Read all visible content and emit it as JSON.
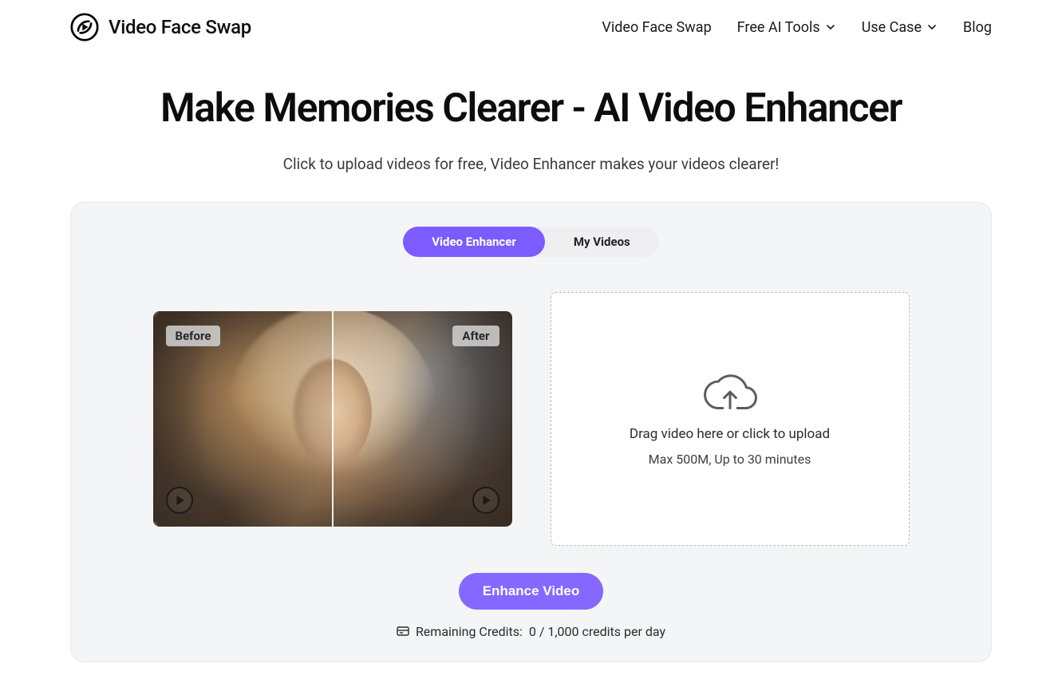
{
  "brand": {
    "title": "Video Face Swap"
  },
  "nav": {
    "items": [
      {
        "label": "Video Face Swap",
        "has_caret": false
      },
      {
        "label": "Free AI Tools",
        "has_caret": true
      },
      {
        "label": "Use Case",
        "has_caret": true
      },
      {
        "label": "Blog",
        "has_caret": false
      }
    ]
  },
  "hero": {
    "title": "Make Memories Clearer - AI Video Enhancer",
    "subtitle": "Click to upload videos for free, Video Enhancer makes your videos clearer!"
  },
  "tabs": {
    "active": "Video Enhancer",
    "inactive": "My Videos"
  },
  "preview": {
    "before_label": "Before",
    "after_label": "After"
  },
  "drop": {
    "instruction": "Drag video here or click to upload",
    "limits": "Max 500M, Up to 30 minutes"
  },
  "actions": {
    "enhance_label": "Enhance Video"
  },
  "credits": {
    "label": "Remaining Credits:",
    "value": "0 / 1,000 credits per day"
  }
}
